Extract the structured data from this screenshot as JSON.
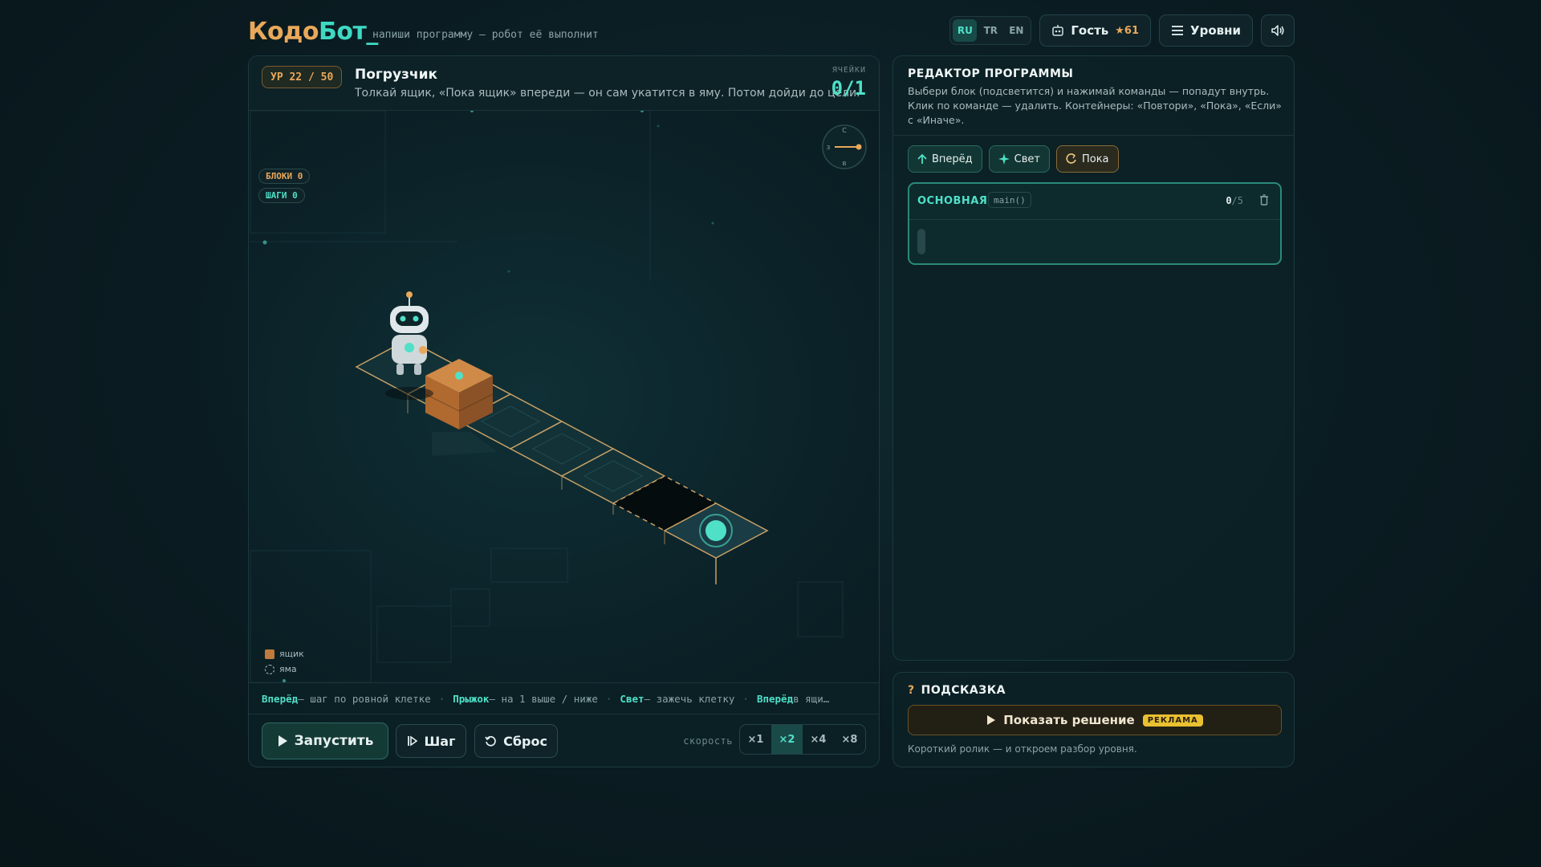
{
  "header": {
    "logo_part1": "Кодо",
    "logo_part2": "Бот_",
    "tagline": "напиши программу — робот её выполнит",
    "languages": [
      "RU",
      "TR",
      "EN"
    ],
    "active_language": "RU",
    "user_name": "Гость",
    "user_stars": "★61",
    "levels_label": "Уровни"
  },
  "level": {
    "badge": "УР 22 / 50",
    "title": "Погрузчик",
    "description": "Толкай ящик, «Пока ящик» впереди — он сам укатится в яму. Потом дойди до цели.",
    "cells_label": "ЯЧЕЙКИ",
    "cells_value": "0/1",
    "blocks_chip": "БЛОКИ 0",
    "steps_chip": "ШАГИ 0",
    "compass": {
      "n": "С",
      "w": "З",
      "s": "В"
    },
    "legend": [
      {
        "name": "ящик",
        "icon": "box-swatch"
      },
      {
        "name": "яма",
        "icon": "pit-swatch"
      }
    ]
  },
  "hint_bar": [
    {
      "cmd": "Вперёд",
      "text": " — шаг по ровной клетке"
    },
    {
      "cmd": "Прыжок",
      "text": " — на 1 выше / ниже"
    },
    {
      "cmd": "Свет",
      "text": " — зажечь клетку"
    },
    {
      "cmd": "Вперёд",
      "text": " в ящи…"
    }
  ],
  "controls": {
    "run_label": "Запустить",
    "step_label": "Шаг",
    "reset_label": "Сброс",
    "speed_label": "скорость",
    "speeds": [
      "×1",
      "×2",
      "×4",
      "×8"
    ],
    "active_speed": "×2"
  },
  "editor": {
    "title": "РЕДАКТОР ПРОГРАММЫ",
    "description": "Выбери блок (подсветится) и нажимай команды — попадут внутрь. Клик по команде — удалить. Контейнеры: «Повтори», «Пока», «Если» с «Иначе».",
    "blocks": [
      {
        "label": "Вперёд",
        "icon": "arrow-up-icon"
      },
      {
        "label": "Свет",
        "icon": "sparkle-icon"
      },
      {
        "label": "Пока",
        "icon": "loop-icon"
      }
    ],
    "main_name": "ОСНОВНАЯ",
    "main_signature": "main()",
    "main_count": "0",
    "main_limit": "/5"
  },
  "hint_panel": {
    "title": "ПОДСКАЗКА",
    "show_solution": "Показать решение",
    "ad_badge": "РЕКЛАМА",
    "note": "Короткий ролик — и откроем разбор уровня."
  },
  "colors": {
    "accent_teal": "#4fe0c8",
    "accent_orange": "#e9a85a",
    "box": "#c07a3c"
  }
}
